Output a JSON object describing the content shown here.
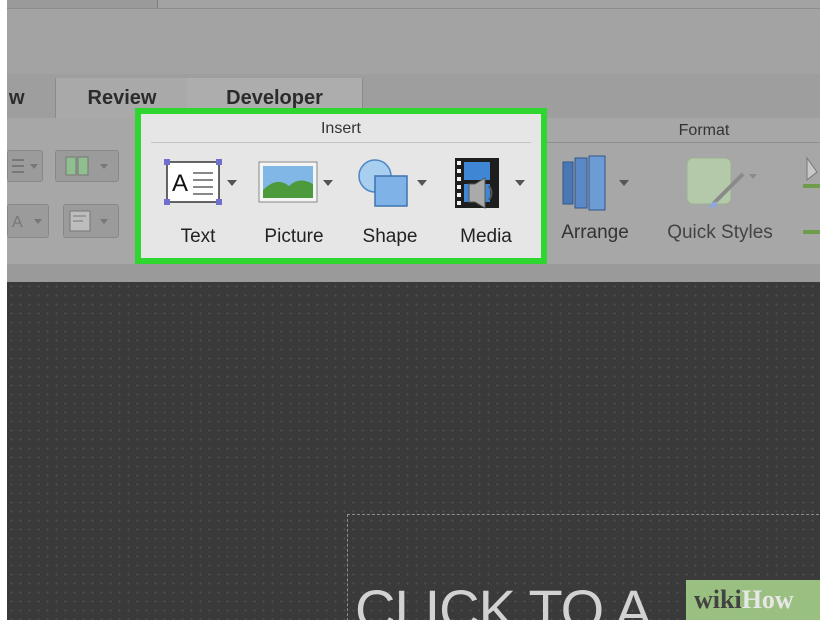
{
  "tabs": [
    {
      "label": "w"
    },
    {
      "label": "Review"
    },
    {
      "label": "Developer"
    }
  ],
  "insert_group": {
    "title": "Insert",
    "items": [
      {
        "label": "Text",
        "icon": "text-box-icon"
      },
      {
        "label": "Picture",
        "icon": "picture-icon"
      },
      {
        "label": "Shape",
        "icon": "shape-icon"
      },
      {
        "label": "Media",
        "icon": "media-icon"
      }
    ],
    "highlight_color": "#2fd62f"
  },
  "format_group": {
    "title": "Format",
    "items": [
      {
        "label": "Arrange",
        "icon": "arrange-icon"
      },
      {
        "label": "Quick Styles",
        "icon": "quick-styles-icon"
      }
    ]
  },
  "slide": {
    "placeholder_text": "CLICK TO A"
  },
  "watermark": {
    "prefix": "wiki",
    "suffix": "How"
  }
}
